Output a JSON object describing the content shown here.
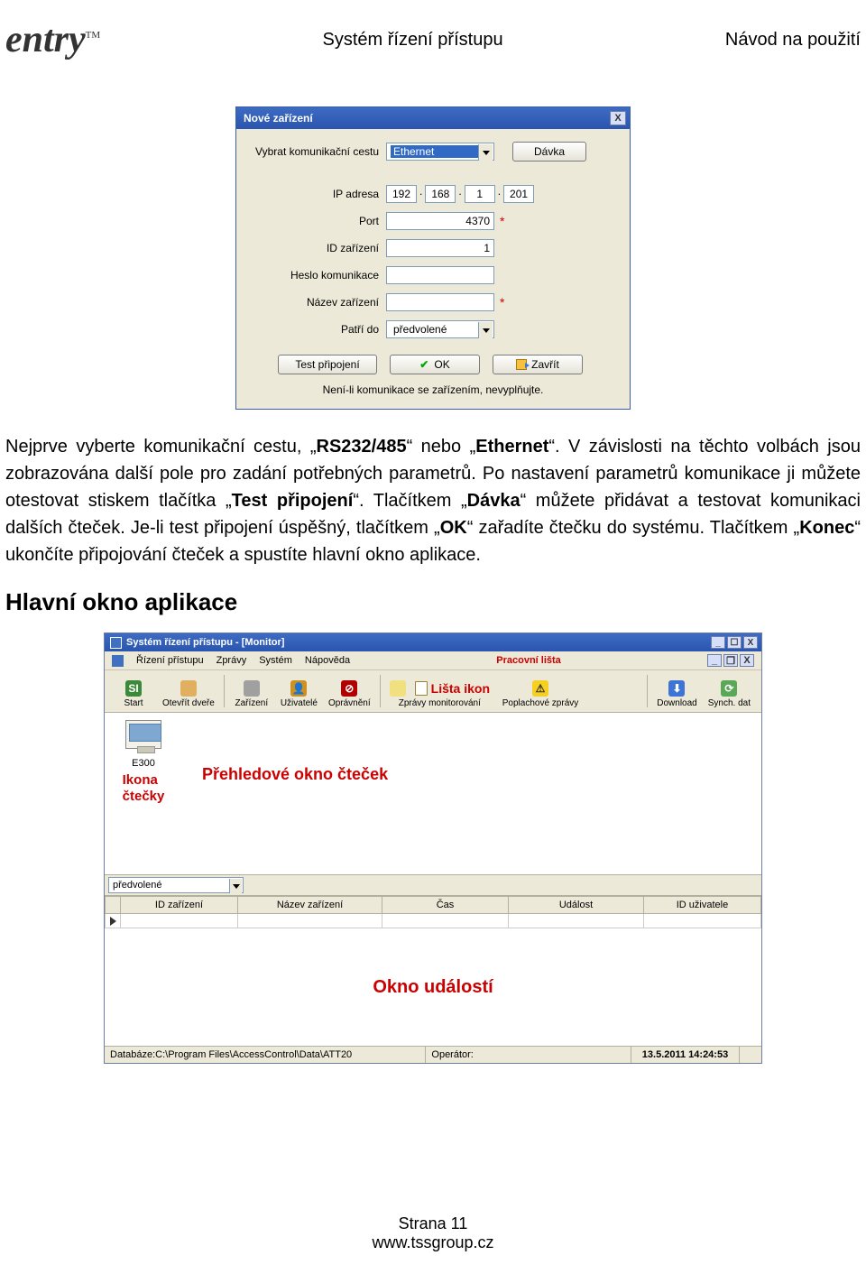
{
  "header": {
    "logo_text": "entry",
    "logo_tm": "TM",
    "title": "Systém řízení přístupu",
    "right": "Návod na použití"
  },
  "dialog": {
    "title": "Nové zařízení",
    "close": "X",
    "comm_label": "Vybrat komunikační cestu",
    "comm_value": "Ethernet",
    "batch_btn": "Dávka",
    "ip_label": "IP adresa",
    "ip_a": "192",
    "ip_b": "168",
    "ip_c": "1",
    "ip_d": "201",
    "port_label": "Port",
    "port_value": "4370",
    "devid_label": "ID zařízení",
    "devid_value": "1",
    "pwd_label": "Heslo komunikace",
    "pwd_value": "",
    "name_label": "Název zařízení",
    "name_value": "",
    "area_label": "Patří do",
    "area_value": "předvolené",
    "test_btn": "Test připojení",
    "ok_btn": "OK",
    "close_btn": "Zavřít",
    "warn": "Není-li komunikace se zařízením, nevyplňujte."
  },
  "body": {
    "p1a": "Nejprve vyberte komunikační cestu, „",
    "p1b": "RS232/485",
    "p1c": "“ nebo „",
    "p1d": "Ethernet",
    "p1e": "“. V závislosti na těchto volbách jsou zobrazována další pole pro zadání potřebných parametrů. Po nastavení parametrů komunikace ji můžete otestovat stiskem tlačítka „",
    "p1f": "Test připojení",
    "p1g": "“. Tlačítkem „",
    "p1h": "Dávka",
    "p1i": "“ můžete přidávat a testovat komunikaci dalších čteček. Je-li test připojení úspěšný, tlačítkem „",
    "p1j": "OK",
    "p1k": "“ zařadíte čtečku do systému. Tlačítkem „",
    "p1l": "Konec",
    "p1m": "“ ukončíte připojování čteček a spustíte hlavní okno aplikace.",
    "section": "Hlavní okno aplikace"
  },
  "app": {
    "title": "Systém řízení přístupu - [Monitor]",
    "menus": [
      "Řízení přístupu",
      "Zprávy",
      "Systém",
      "Nápověda"
    ],
    "annot_pracovni": "Pracovní lišta",
    "annot_lista_ikon": "Lišta ikon",
    "tools": [
      {
        "id": "start",
        "label": "Start",
        "cls": "ic-start",
        "glyph": "SI"
      },
      {
        "id": "open",
        "label": "Otevřít dveře",
        "cls": "ic-door",
        "glyph": ""
      },
      {
        "id": "dev",
        "label": "Zařízení",
        "cls": "ic-dev",
        "glyph": ""
      },
      {
        "id": "users",
        "label": "Uživatelé",
        "cls": "ic-user",
        "glyph": "👤"
      },
      {
        "id": "perm",
        "label": "Oprávnění",
        "cls": "ic-perm",
        "glyph": "⊘"
      },
      {
        "id": "monrep",
        "label": "Zprávy monitorování",
        "cls": "ic-rep",
        "glyph": "📄"
      },
      {
        "id": "alarm",
        "label": "Poplachové zprávy",
        "cls": "ic-ala",
        "glyph": "⚠"
      },
      {
        "id": "dl",
        "label": "Download",
        "cls": "ic-dl",
        "glyph": "⬇"
      },
      {
        "id": "sync",
        "label": "Synch. dat",
        "cls": "ic-sync",
        "glyph": "⟳"
      }
    ],
    "reader_name": "E300",
    "annot_ikona_l1": "Ikona",
    "annot_ikona_l2": "čtečky",
    "annot_center": "Přehledové okno čteček",
    "dd_value": "předvolené",
    "grid_cols": [
      "",
      "ID zařízení",
      "Název zařízení",
      "Čas",
      "Událost",
      "ID uživatele"
    ],
    "events_label": "Okno událostí",
    "status_db": "Databáze:C:\\Program Files\\AccessControl\\Data\\ATT20",
    "status_op": "Operátor:",
    "status_time": "13.5.2011 14:24:53"
  },
  "footer": {
    "page": "Strana 11",
    "url": "www.tssgroup.cz"
  }
}
